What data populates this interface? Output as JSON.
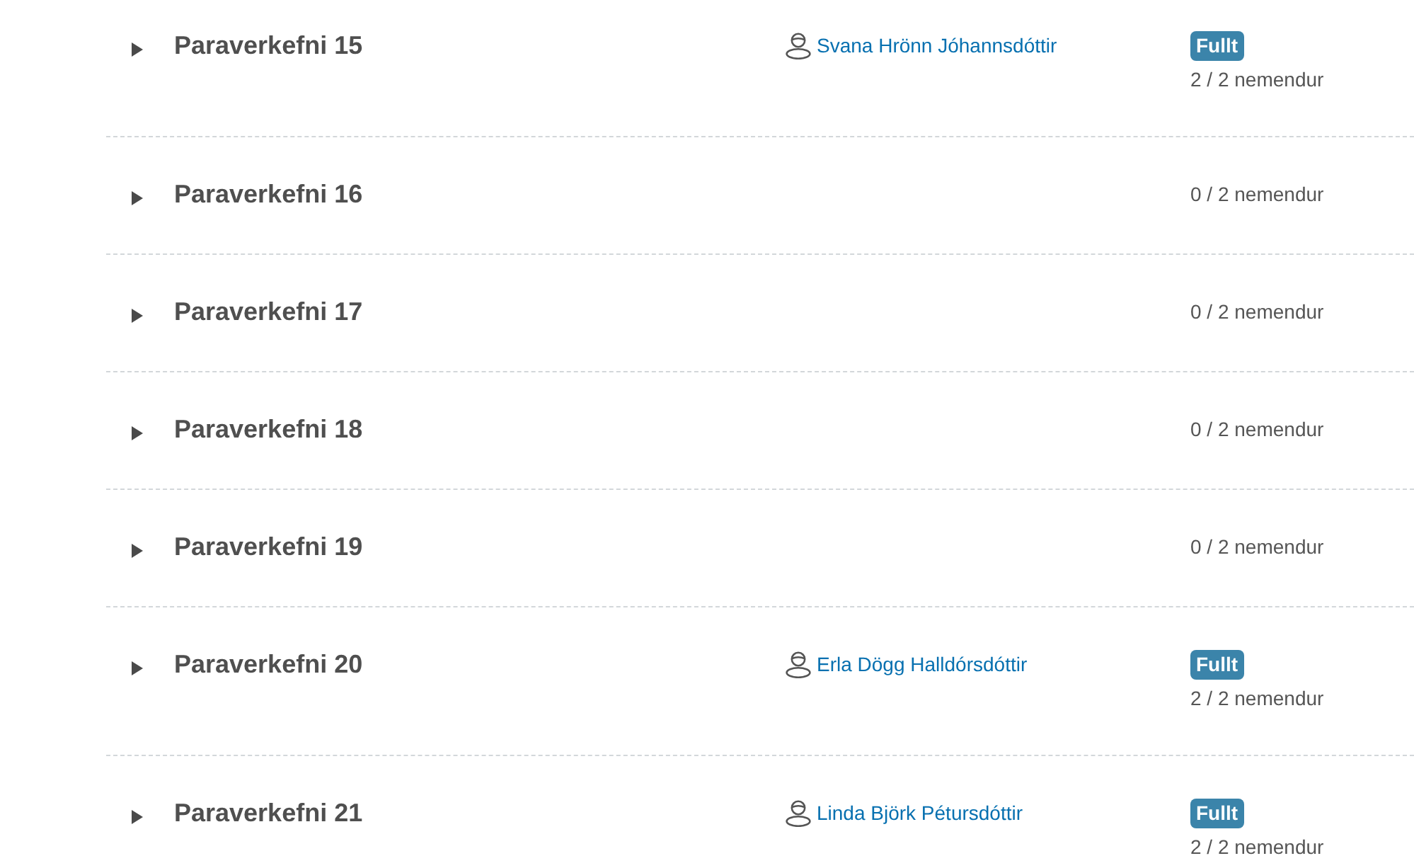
{
  "groups": [
    {
      "title": "Paraverkefni 15",
      "expanded": false,
      "person": "Svana Hrönn Jóhannsdóttir",
      "badge": "Fullt",
      "count": "2 / 2 nemendur"
    },
    {
      "title": "Paraverkefni 16",
      "expanded": false,
      "count": "0 / 2 nemendur"
    },
    {
      "title": "Paraverkefni 17",
      "expanded": false,
      "count": "0 / 2 nemendur"
    },
    {
      "title": "Paraverkefni 18",
      "expanded": false,
      "count": "0 / 2 nemendur"
    },
    {
      "title": "Paraverkefni 19",
      "expanded": false,
      "count": "0 / 2 nemendur"
    },
    {
      "title": "Paraverkefni 20",
      "expanded": false,
      "person": "Erla Dögg Halldórsdóttir",
      "badge": "Fullt",
      "count": "2 / 2 nemendur"
    },
    {
      "title": "Paraverkefni 21",
      "expanded": false,
      "person": "Linda Björk Pétursdóttir",
      "badge": "Fullt",
      "count": "2 / 2 nemendur"
    }
  ]
}
